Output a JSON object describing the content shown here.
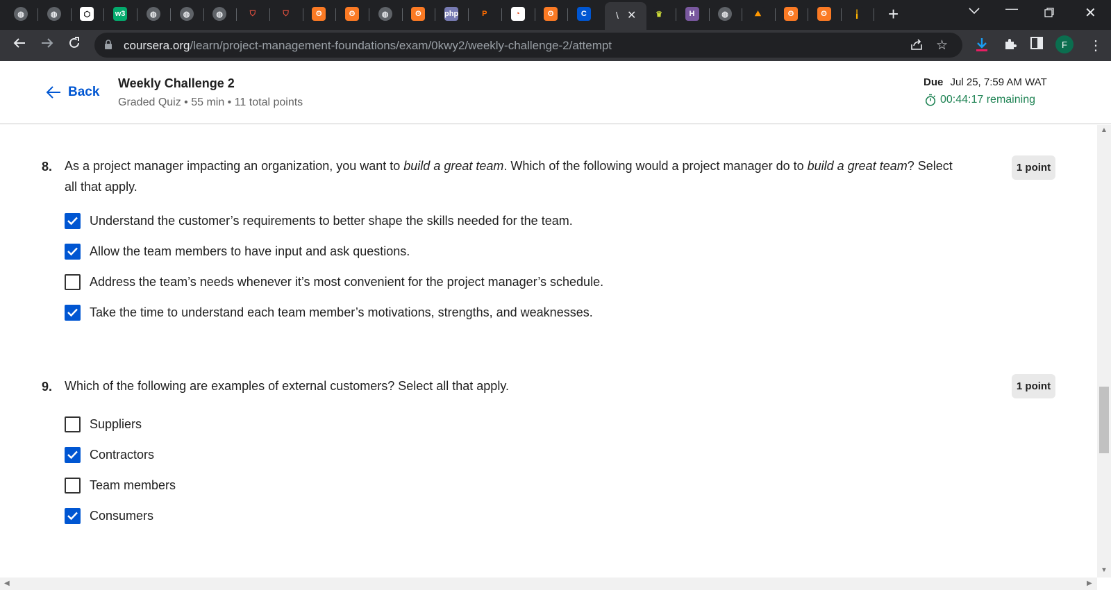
{
  "browser": {
    "tabs": [
      {
        "icon": "globe-icon"
      },
      {
        "icon": "globe-icon"
      },
      {
        "icon": "codepen-icon"
      },
      {
        "icon": "w3schools-icon",
        "text": "w3"
      },
      {
        "icon": "globe-icon"
      },
      {
        "icon": "globe-icon"
      },
      {
        "icon": "globe-icon"
      },
      {
        "icon": "laravel-icon"
      },
      {
        "icon": "laravel-icon"
      },
      {
        "icon": "xampp-icon"
      },
      {
        "icon": "xampp-icon"
      },
      {
        "icon": "globe-icon"
      },
      {
        "icon": "xampp-icon"
      },
      {
        "icon": "php-icon",
        "text": "php"
      },
      {
        "icon": "p-icon",
        "text": "P"
      },
      {
        "icon": "chart-icon"
      },
      {
        "icon": "xampp-icon"
      },
      {
        "icon": "coursera-icon",
        "text": "C"
      }
    ],
    "active_tab": {
      "title": "\\"
    },
    "tabs_after": [
      {
        "icon": "cap-icon"
      },
      {
        "icon": "heroku-icon",
        "text": "H"
      },
      {
        "icon": "globe-icon"
      },
      {
        "icon": "mountain-icon"
      },
      {
        "icon": "xampp-icon"
      },
      {
        "icon": "xampp-icon"
      },
      {
        "icon": "bar-icon"
      }
    ],
    "url_host": "coursera.org",
    "url_path": "/learn/project-management-foundations/exam/0kwy2/weekly-challenge-2/attempt",
    "profile_initial": "F"
  },
  "header": {
    "back_label": "Back",
    "title": "Weekly Challenge 2",
    "meta": "Graded Quiz • 55 min • 11 total points",
    "due_label": "Due",
    "due_value": "Jul 25, 7:59 AM WAT",
    "timer": "00:44:17 remaining"
  },
  "questions": [
    {
      "number": "8.",
      "text_parts": [
        "As a project manager impacting an organization, you want to ",
        "build a great team",
        ". Which of the following would a project manager do to ",
        "build a great team",
        "? Select all that apply."
      ],
      "points": "1 point",
      "options": [
        {
          "label": "Understand the customer’s requirements to better shape the skills needed for the team.",
          "checked": true
        },
        {
          "label": "Allow the team members to have input and ask questions.",
          "checked": true
        },
        {
          "label": "Address the team’s needs whenever it’s most convenient for the project manager’s schedule.",
          "checked": false
        },
        {
          "label": "Take the time to understand each team member’s motivations, strengths, and weaknesses.",
          "checked": true
        }
      ]
    },
    {
      "number": "9.",
      "text": "Which of the following are examples of external customers? Select all that apply.",
      "points": "1 point",
      "options": [
        {
          "label": "Suppliers",
          "checked": false
        },
        {
          "label": "Contractors",
          "checked": true
        },
        {
          "label": "Team members",
          "checked": false
        },
        {
          "label": "Consumers",
          "checked": true
        }
      ]
    }
  ],
  "colors": {
    "accent": "#0056d2",
    "timer_green": "#1f8354",
    "chrome_dark": "#202124",
    "chrome_toolbar": "#35363a"
  }
}
